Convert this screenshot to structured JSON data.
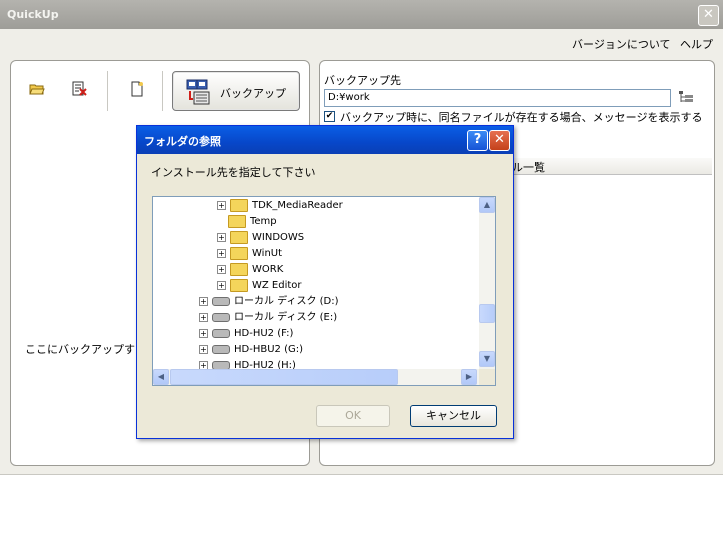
{
  "window": {
    "title": "QuickUp",
    "close_glyph": "✕"
  },
  "menu": {
    "items": [
      "バージョンについて",
      "ヘルプ"
    ]
  },
  "toolbar": {
    "icons": [
      "open-folder-icon",
      "delete-icon",
      "new-file-icon"
    ],
    "backup_label": "バックアップ"
  },
  "left_panel": {
    "drop_hint": "ここにバックアップする"
  },
  "right_panel": {
    "dest_label": "バックアップ先",
    "dest_value": "D:¥work",
    "confirm_checked": true,
    "confirm_label": "バックアップ時に、同名ファイルが存在する場合、メッセージを表示する",
    "list_header": "ル一覧"
  },
  "dialog": {
    "title": "フォルダの参照",
    "help_glyph": "?",
    "close_glyph": "✕",
    "instruction": "インストール先を指定して下さい",
    "tree": [
      {
        "label": "TDK_MediaReader",
        "kind": "folder",
        "expander": true
      },
      {
        "label": "Temp",
        "kind": "folder",
        "expander": false
      },
      {
        "label": "WINDOWS",
        "kind": "folder",
        "expander": true
      },
      {
        "label": "WinUt",
        "kind": "folder",
        "expander": true
      },
      {
        "label": "WORK",
        "kind": "folder",
        "expander": true
      },
      {
        "label": "WZ Editor",
        "kind": "folder",
        "expander": true
      },
      {
        "label": "ローカル ディスク (D:)",
        "kind": "drive",
        "expander": true
      },
      {
        "label": "ローカル ディスク (E:)",
        "kind": "drive",
        "expander": true
      },
      {
        "label": "HD-HU2 (F:)",
        "kind": "drive",
        "expander": true
      },
      {
        "label": "HD-HBU2 (G:)",
        "kind": "drive",
        "expander": true
      },
      {
        "label": "HD-HU2 (H:)",
        "kind": "drive",
        "expander": true
      }
    ],
    "ok_label": "OK",
    "cancel_label": "キャンセル"
  },
  "colors": {
    "dialog_title": "#0a5ee6",
    "window_title": "#b4b3ae",
    "folder": "#f4d55b"
  }
}
